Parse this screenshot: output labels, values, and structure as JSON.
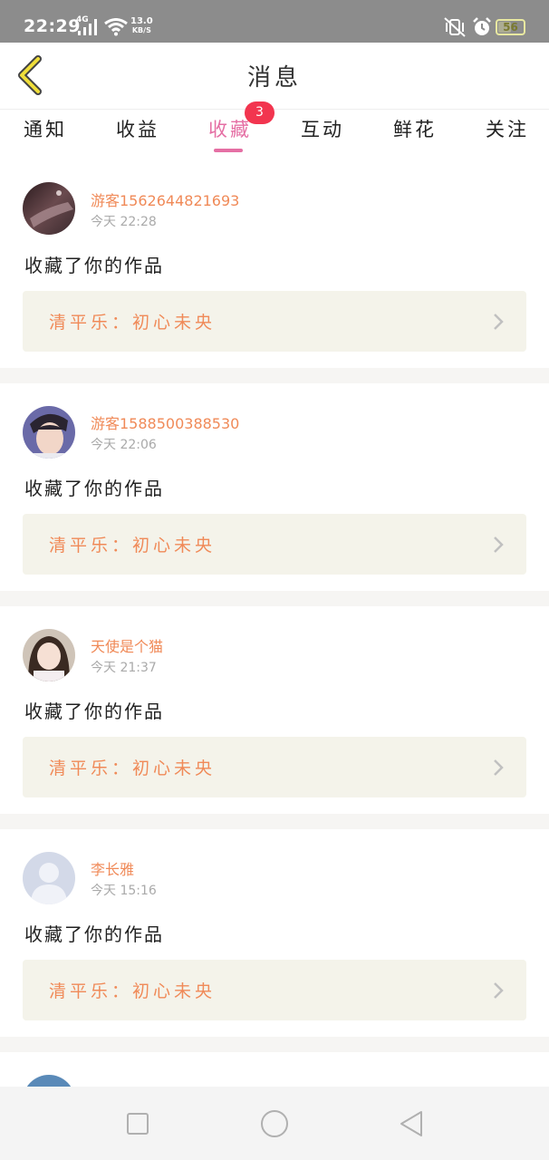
{
  "status_bar": {
    "time": "22:29",
    "network": "4G",
    "speed_value": "13.0",
    "speed_unit": "KB/S",
    "battery": "56"
  },
  "header": {
    "title": "消息"
  },
  "tabs": [
    {
      "label": "通知",
      "active": false
    },
    {
      "label": "收益",
      "active": false
    },
    {
      "label": "收藏",
      "active": true,
      "badge": "3"
    },
    {
      "label": "互动",
      "active": false
    },
    {
      "label": "鲜花",
      "active": false
    },
    {
      "label": "关注",
      "active": false
    }
  ],
  "items": [
    {
      "username": "游客1562644821693",
      "time": "今天 22:28",
      "action": "收藏了你的作品",
      "work_title": "清平乐：初心未央"
    },
    {
      "username": "游客1588500388530",
      "time": "今天 22:06",
      "action": "收藏了你的作品",
      "work_title": "清平乐：初心未央"
    },
    {
      "username": "天使是个猫",
      "time": "今天 21:37",
      "action": "收藏了你的作品",
      "work_title": "清平乐：初心未央"
    },
    {
      "username": "李长雅",
      "time": "今天 15:16",
      "action": "收藏了你的作品",
      "work_title": "清平乐：初心未央"
    }
  ],
  "colors": {
    "accent": "#e56fa4",
    "username": "#f08a58",
    "badge": "#f2354f",
    "work_bg": "#f4f3ea"
  },
  "icons": {
    "back": "chevron-left-icon",
    "work_arrow": "chevron-right-icon",
    "nav_recent": "square-icon",
    "nav_home": "circle-icon",
    "nav_back": "triangle-back-icon"
  }
}
